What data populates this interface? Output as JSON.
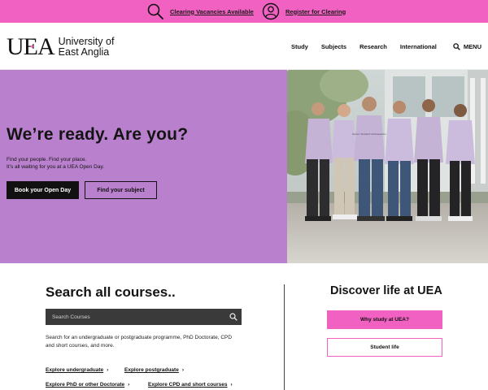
{
  "topbar": {
    "clearing_vacancies": "Clearing Vacancies Available",
    "register_clearing": "Register for Clearing",
    "color": "#f061c1"
  },
  "logo": {
    "mark": "UEA",
    "line1": "University of",
    "line2": "East Anglia"
  },
  "nav": {
    "items": [
      "Study",
      "Subjects",
      "Research",
      "International"
    ],
    "menu_label": "MENU"
  },
  "hero": {
    "title": "We’re ready. Are you?",
    "line1": "Find your people. Find your place.",
    "line2": "It’s all waiting for you at a UEA Open Day.",
    "primary_button": "Book your Open Day",
    "secondary_button": "Find your subject",
    "bg_color": "#b981cd",
    "hoodie_text": "Senior Student Ambassador"
  },
  "search": {
    "title": "Search all courses..",
    "placeholder": "Search Courses",
    "description": "Search for an undergraduate or postgraduate programme, PhD Doctorate, CPD and short courses, and more.",
    "links": [
      "Explore undergraduate",
      "Explore postgraduate",
      "Explore PhD or other Doctorate",
      "Explore CPD and short courses"
    ]
  },
  "discover": {
    "title": "Discover life at UEA",
    "button1": "Why study at UEA?",
    "button2": "Student life"
  }
}
